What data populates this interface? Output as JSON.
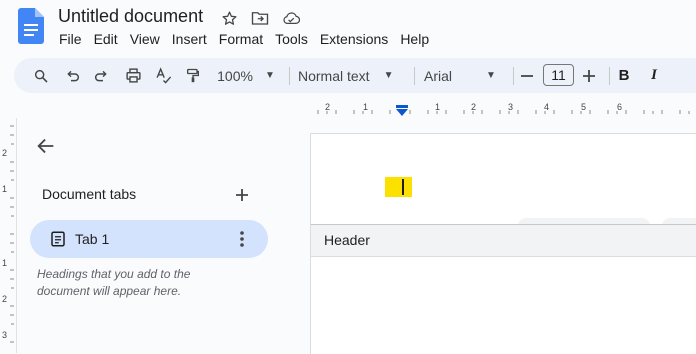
{
  "document": {
    "title": "Untitled document"
  },
  "menu": [
    "File",
    "Edit",
    "View",
    "Insert",
    "Format",
    "Tools",
    "Extensions",
    "Help"
  ],
  "toolbar": {
    "zoom": "100%",
    "style": "Normal text",
    "font": "Arial",
    "font_size": "11",
    "bold": "B",
    "italic": "I"
  },
  "ruler": {
    "horizontal": [
      "2",
      "1",
      "1",
      "2",
      "3",
      "4",
      "5",
      "6"
    ],
    "vertical": [
      "2",
      "1",
      "1",
      "2",
      "3"
    ]
  },
  "sidebar": {
    "heading": "Document tabs",
    "tabs": [
      {
        "label": "Tab 1"
      }
    ],
    "hint": "Headings that you add to the document will appear here."
  },
  "page": {
    "header_label": "Header"
  },
  "colors": {
    "accent": "#0b57d0",
    "tab_selected": "#d3e3fd",
    "cursor_highlight": "#fce100"
  },
  "icons": [
    "docs-logo",
    "star-icon",
    "move-folder-icon",
    "cloud-status-icon",
    "search-icon",
    "undo-icon",
    "redo-icon",
    "print-icon",
    "spellcheck-icon",
    "paint-format-icon",
    "back-arrow-icon",
    "add-icon",
    "document-icon",
    "more-vert-icon"
  ]
}
